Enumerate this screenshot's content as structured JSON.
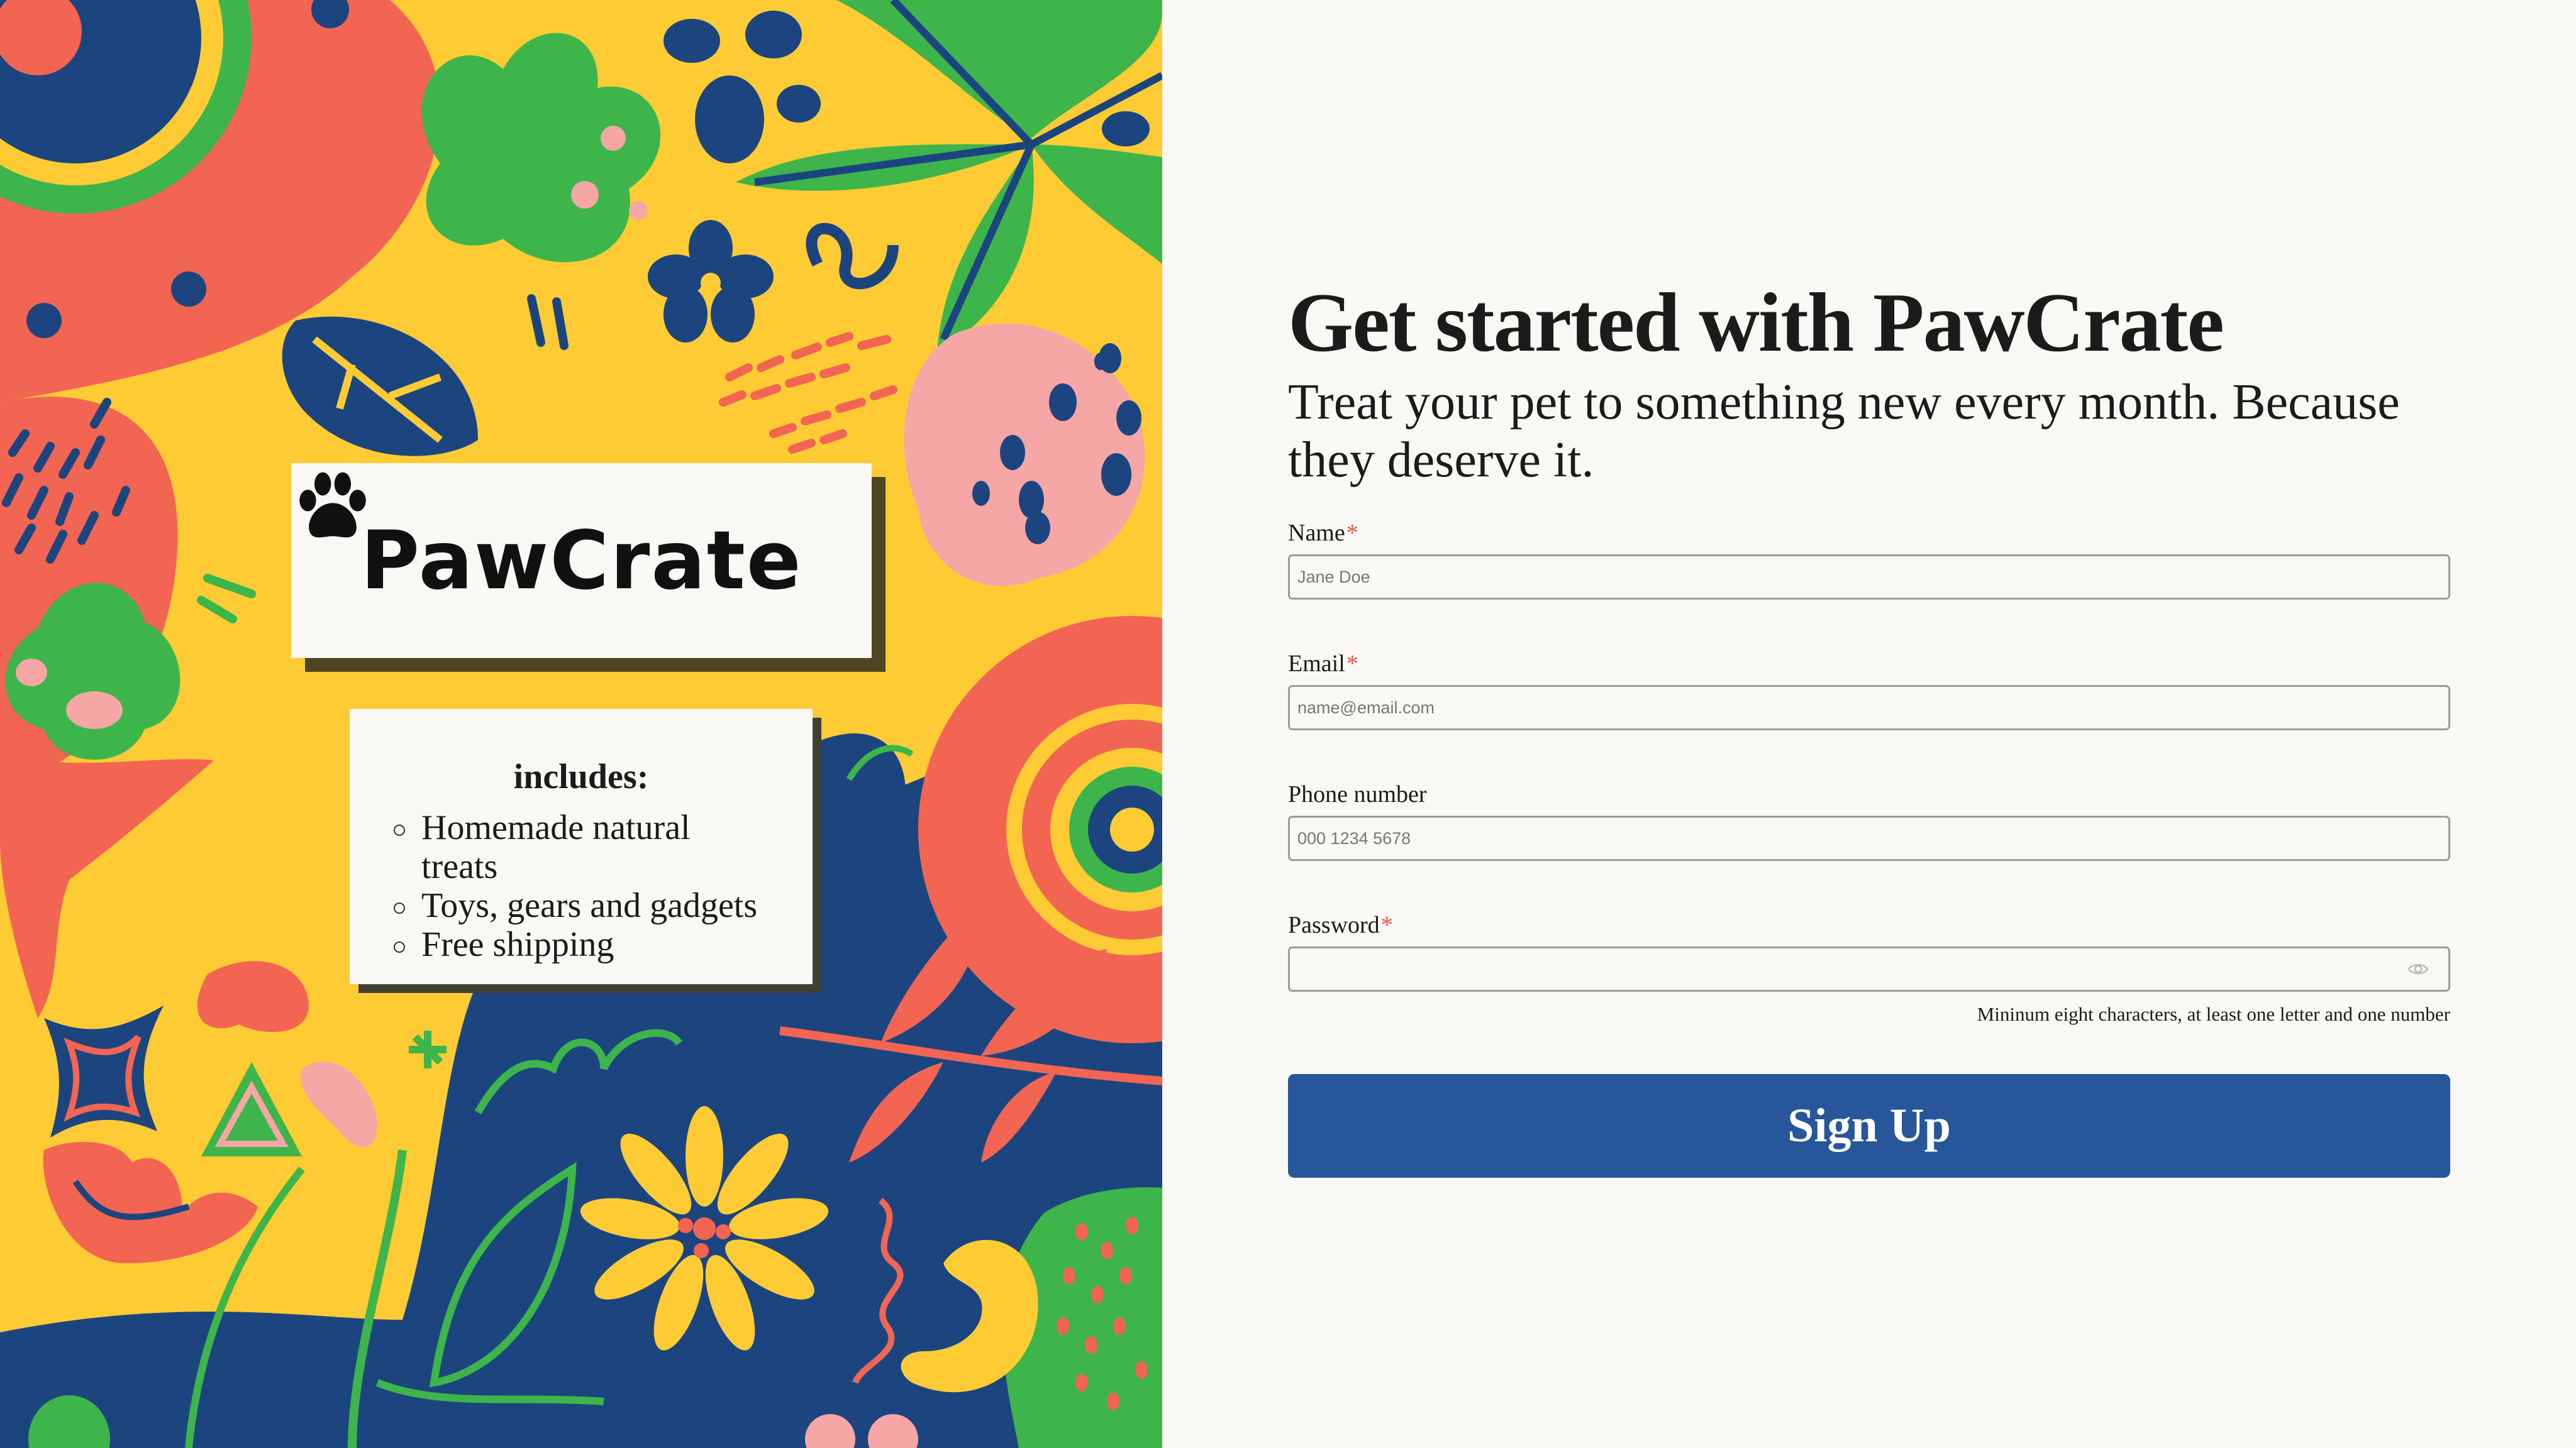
{
  "brand": {
    "name": "PawCrate",
    "logo_icon": "paw-print-icon"
  },
  "includes": {
    "title": "includes:",
    "items": [
      "Homemade natural treats",
      "Toys, gears and gadgets",
      "Free shipping"
    ]
  },
  "header": {
    "title": "Get started with PawCrate",
    "subtitle": "Treat your pet to something new every month. Because they deserve it."
  },
  "form": {
    "name": {
      "label": "Name",
      "required_mark": "*",
      "placeholder": "Jane Doe",
      "value": ""
    },
    "email": {
      "label": "Email",
      "required_mark": "*",
      "placeholder": "name@email.com",
      "value": ""
    },
    "phone": {
      "label": "Phone number",
      "placeholder": "000 1234 5678",
      "value": ""
    },
    "password": {
      "label": "Password",
      "required_mark": "*",
      "value": "",
      "toggle_icon": "eye-icon",
      "hint": "Mininum eight characters, at least one letter and one number"
    },
    "submit_label": "Sign Up"
  },
  "colors": {
    "background": "#faf8f4",
    "accent": "#27579a",
    "required": "#e05545",
    "art_yellow": "#fecb35",
    "art_coral": "#f26552",
    "art_navy": "#1c4580",
    "art_green": "#3db54a",
    "art_pink": "#f6a6a4"
  }
}
